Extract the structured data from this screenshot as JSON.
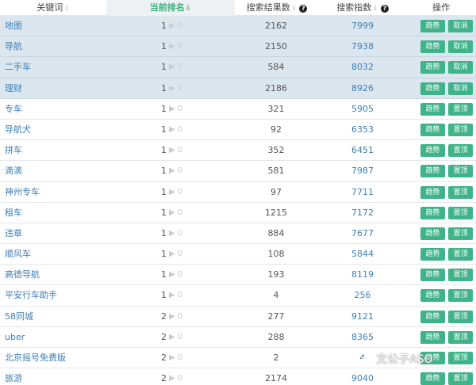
{
  "header": {
    "keyword": "关键词",
    "rank": "当前排名",
    "results": "搜索结果数",
    "index": "搜索指数",
    "actions": "操作"
  },
  "labels": {
    "trend": "趋势",
    "cancel": "取消",
    "top": "置顶"
  },
  "rows": [
    {
      "keyword": "地图",
      "rank": "1",
      "delta": "0",
      "results": "2162",
      "index": "7999",
      "pinned": true
    },
    {
      "keyword": "导航",
      "rank": "1",
      "delta": "0",
      "results": "2150",
      "index": "7938",
      "pinned": true
    },
    {
      "keyword": "二手车",
      "rank": "1",
      "delta": "0",
      "results": "584",
      "index": "8032",
      "pinned": true
    },
    {
      "keyword": "理财",
      "rank": "1",
      "delta": "0",
      "results": "2186",
      "index": "8926",
      "pinned": true
    },
    {
      "keyword": "专车",
      "rank": "1",
      "delta": "0",
      "results": "321",
      "index": "5905",
      "pinned": false
    },
    {
      "keyword": "导航犬",
      "rank": "1",
      "delta": "0",
      "results": "92",
      "index": "6353",
      "pinned": false
    },
    {
      "keyword": "拼车",
      "rank": "1",
      "delta": "0",
      "results": "352",
      "index": "6451",
      "pinned": false
    },
    {
      "keyword": "滴滴",
      "rank": "1",
      "delta": "0",
      "results": "581",
      "index": "7987",
      "pinned": false
    },
    {
      "keyword": "神州专车",
      "rank": "1",
      "delta": "0",
      "results": "97",
      "index": "7711",
      "pinned": false
    },
    {
      "keyword": "租车",
      "rank": "1",
      "delta": "0",
      "results": "1215",
      "index": "7172",
      "pinned": false
    },
    {
      "keyword": "违章",
      "rank": "1",
      "delta": "0",
      "results": "884",
      "index": "7677",
      "pinned": false
    },
    {
      "keyword": "顺风车",
      "rank": "1",
      "delta": "0",
      "results": "108",
      "index": "5844",
      "pinned": false
    },
    {
      "keyword": "高德导航",
      "rank": "1",
      "delta": "0",
      "results": "193",
      "index": "8119",
      "pinned": false
    },
    {
      "keyword": "平安行车助手",
      "rank": "1",
      "delta": "0",
      "results": "4",
      "index": "256",
      "pinned": false
    },
    {
      "keyword": "58同城",
      "rank": "2",
      "delta": "0",
      "results": "277",
      "index": "9121",
      "pinned": false
    },
    {
      "keyword": "uber",
      "rank": "2",
      "delta": "0",
      "results": "288",
      "index": "8365",
      "pinned": false
    },
    {
      "keyword": "北京摇号免费版",
      "rank": "2",
      "delta": "0",
      "results": "2",
      "index": "4",
      "pinned": false
    },
    {
      "keyword": "旅游",
      "rank": "2",
      "delta": "0",
      "results": "2174",
      "index": "9040",
      "pinned": false
    }
  ],
  "watermark": {
    "text": "文公子ASO"
  },
  "colors": {
    "accent_green": "#3fb38a",
    "link_blue": "#3d7fb6",
    "pinned_row_bg": "#dbe6ef"
  }
}
